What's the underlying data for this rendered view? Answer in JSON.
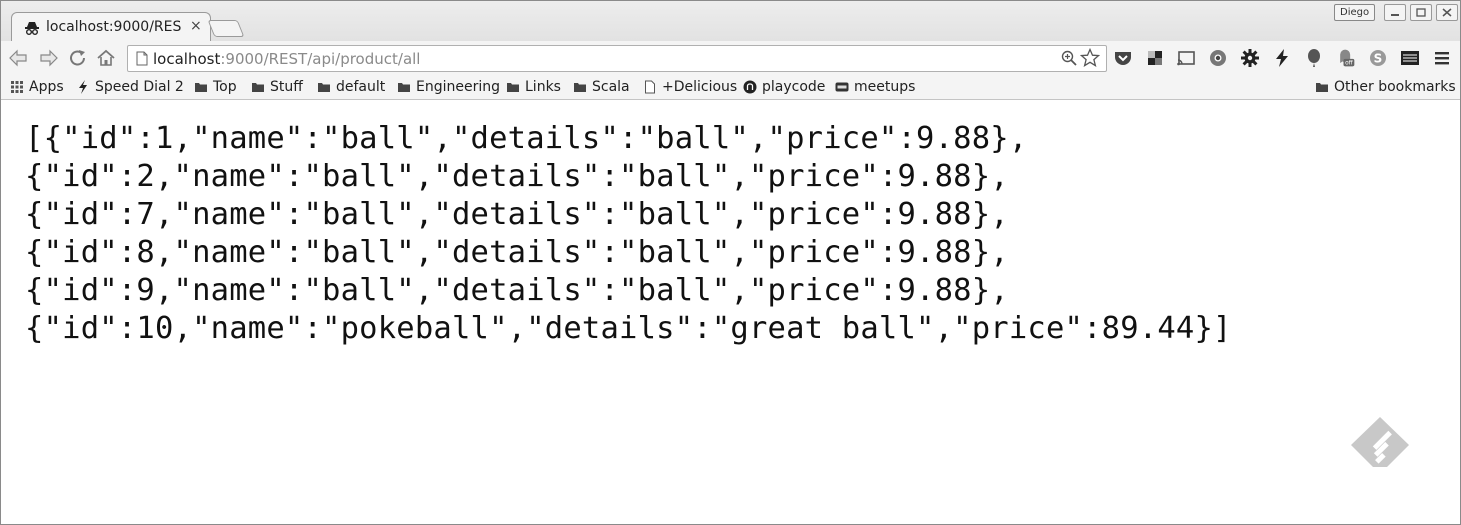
{
  "tab": {
    "title": "localhost:9000/RES",
    "close_glyph": "×"
  },
  "window": {
    "user_badge": "Diego"
  },
  "address_bar": {
    "host": "localhost",
    "path": ":9000/REST/api/product/all"
  },
  "bookmarks": [
    {
      "label": "Apps",
      "icon": "apps-grid-icon"
    },
    {
      "label": "Speed Dial 2",
      "icon": "lightning-icon"
    },
    {
      "label": "Top",
      "icon": "folder-icon"
    },
    {
      "label": "Stuff",
      "icon": "folder-icon"
    },
    {
      "label": "default",
      "icon": "folder-icon"
    },
    {
      "label": "Engineering",
      "icon": "folder-icon"
    },
    {
      "label": "Links",
      "icon": "folder-icon"
    },
    {
      "label": "Scala",
      "icon": "folder-icon"
    },
    {
      "label": "+Delicious",
      "icon": "page-icon"
    },
    {
      "label": "playcode",
      "icon": "github-icon"
    },
    {
      "label": "meetups",
      "icon": "meetup-icon"
    }
  ],
  "other_bookmarks": "Other bookmarks",
  "extension_icons": [
    "pocket-icon",
    "delicious-ext-icon",
    "cast-icon",
    "chromium-icon",
    "gear-icon",
    "lightning-icon",
    "balloon-icon",
    "ghostery-off-icon",
    "skype-icon",
    "spreadsheet-icon",
    "menu-icon"
  ],
  "ghostery_badge": "off",
  "content": {
    "lines": [
      "[{\"id\":1,\"name\":\"ball\",\"details\":\"ball\",\"price\":9.88},",
      "{\"id\":2,\"name\":\"ball\",\"details\":\"ball\",\"price\":9.88},",
      "{\"id\":7,\"name\":\"ball\",\"details\":\"ball\",\"price\":9.88},",
      "{\"id\":8,\"name\":\"ball\",\"details\":\"ball\",\"price\":9.88},",
      "{\"id\":9,\"name\":\"ball\",\"details\":\"ball\",\"price\":9.88},",
      "{\"id\":10,\"name\":\"pokeball\",\"details\":\"great ball\",\"price\":89.44}]"
    ]
  },
  "colors": {
    "chrome_bg": "#f4f4f4",
    "url_path": "#8a8a8a",
    "feedly_watermark": "#c8c8c8"
  }
}
